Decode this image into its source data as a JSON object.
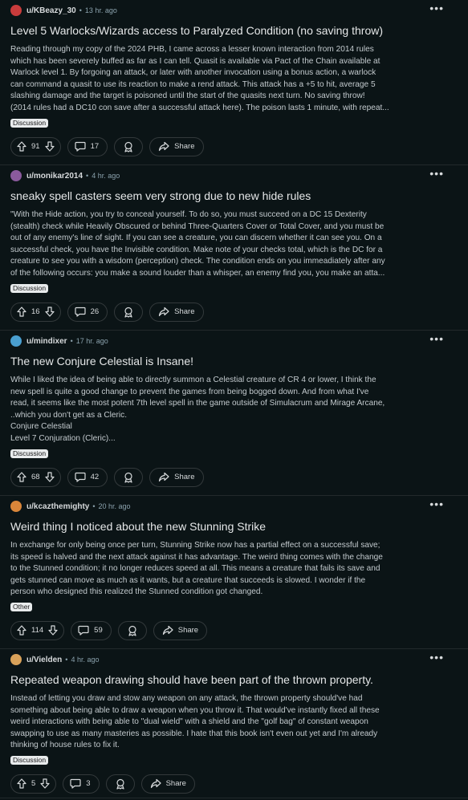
{
  "posts": [
    {
      "user": "u/KBeazy_30",
      "time": "13 hr. ago",
      "title": "Level 5 Warlocks/Wizards access to Paralyzed Condition (no saving throw)",
      "body": "Reading through my copy of the 2024 PHB, I came across a lesser known interaction from 2014 rules\nwhich has been severely buffed as far as I can tell. Quasit is available via Pact of the Chain available at\nWarlock level 1. By forgoing an attack, or later with another invocation using a bonus action, a warlock\ncan command a quasit to use its reaction to make a rend attack. This attack has a +5 to hit, average 5\nslashing damage and the target is poisoned until the start of the quasits next turn. No saving throw!\n(2014 rules had a DC10 con save after a successful attack here). The poison lasts 1 minute, with repeat...",
      "flair": "Discussion",
      "votes": "91",
      "comments": "17",
      "share": "Share",
      "avatar_color": "#c93c3c"
    },
    {
      "user": "u/monikar2014",
      "time": "4 hr. ago",
      "title": "sneaky spell casters seem very strong due to new hide rules",
      "body": "\"With the Hide action, you try to conceal yourself. To do so, you must succeed on a DC 15 Dexterity\n(stealth) check while Heavily Obscured or behind Three-Quarters Cover or Total Cover, and you must be\nout of any enemy's line of sight. If you can see a creature, you can discern whether it can see you. On a\nsuccessful check, you have the Invisible condition. Make note of your checks total, which is the DC for a\ncreature to see you with a wisdom (perception) check. The condition ends on you immeadiately after any\nof the following occurs: you make a sound louder than a whisper, an enemy find you, you make an atta...",
      "flair": "Discussion",
      "votes": "16",
      "comments": "26",
      "share": "Share",
      "avatar_color": "#8a5a9c"
    },
    {
      "user": "u/mindixer",
      "time": "17 hr. ago",
      "title": "The new Conjure Celestial is Insane!",
      "body": "While I liked the idea of being able to directly summon a Celestial creature of CR 4 or lower, I think the\nnew spell is quite a good change to prevent the games from being bogged down. And from what I've\nread, it seems like the most potent 7th level spell in the game outside of Simulacrum and Mirage Arcane,\n..which you don't get as a Cleric.\nConjure Celestial\nLevel 7 Conjuration (Cleric)...",
      "flair": "Discussion",
      "votes": "68",
      "comments": "42",
      "share": "Share",
      "avatar_color": "#4a9fd0"
    },
    {
      "user": "u/kcazthemighty",
      "time": "20 hr. ago",
      "title": "Weird thing I noticed about the new Stunning Strike",
      "body": "In exchange for only being once per turn, Stunning Strike now has a partial effect on a successful save;\nits speed is halved and the next attack against it has advantage. The weird thing comes with the change\nto the Stunned condition; it no longer reduces speed at all. This means a creature that fails its save and\ngets stunned can move as much as it wants, but a creature that succeeds is slowed. I wonder if the\nperson who designed this realized the Stunned condition got changed.",
      "flair": "Other",
      "votes": "114",
      "comments": "59",
      "share": "Share",
      "avatar_color": "#d9863a"
    },
    {
      "user": "u/Vielden",
      "time": "4 hr. ago",
      "title": "Repeated weapon drawing should have been part of the thrown property.",
      "body": "Instead of letting you draw and stow any weapon on any attack, the thrown property should've had\nsomething about being able to draw a weapon when you throw it. That would've instantly fixed all these\nweird interactions with being able to \"dual wield\" with a shield and the \"golf bag\" of constant weapon\nswapping to use as many masteries as possible. I hate that this book isn't even out yet and I'm already\nthinking of house rules to fix it.",
      "flair": "Discussion",
      "votes": "5",
      "comments": "3",
      "share": "Share",
      "avatar_color": "#d9a25a"
    }
  ],
  "time_separator": "•",
  "colors": {
    "background": "#0b1416",
    "divider": "#22292b",
    "meta_text": "#8ba2ad",
    "flair_bg": "#e8ebec"
  },
  "icons": [
    "more-icon",
    "upvote-icon",
    "downvote-icon",
    "comment-icon",
    "award-icon",
    "share-icon"
  ]
}
